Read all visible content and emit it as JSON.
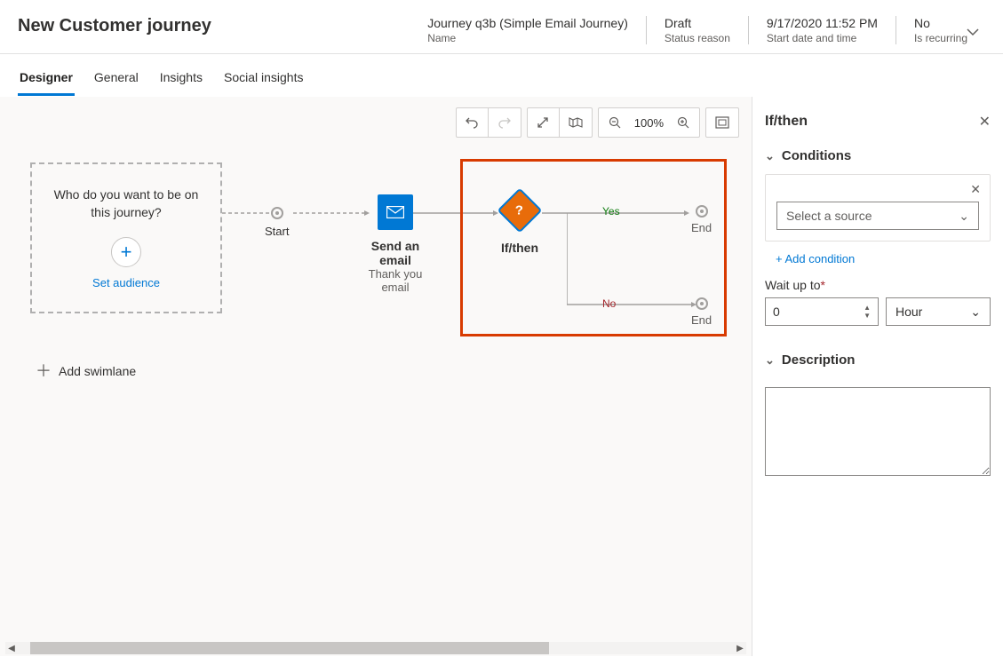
{
  "header": {
    "title": "New Customer journey",
    "fields": [
      {
        "value": "Journey q3b (Simple Email Journey)",
        "label": "Name"
      },
      {
        "value": "Draft",
        "label": "Status reason"
      },
      {
        "value": "9/17/2020 11:52 PM",
        "label": "Start date and time"
      },
      {
        "value": "No",
        "label": "Is recurring"
      }
    ]
  },
  "tabs": [
    "Designer",
    "General",
    "Insights",
    "Social insights"
  ],
  "active_tab": "Designer",
  "toolbar": {
    "zoom": "100%"
  },
  "canvas": {
    "audience_question": "Who do you want to be on this journey?",
    "set_audience": "Set audience",
    "start_label": "Start",
    "email_title": "Send an email",
    "email_sub": "Thank you email",
    "ifthen_title": "If/then",
    "yes": "Yes",
    "no": "No",
    "end": "End",
    "add_swimlane": "Add swimlane"
  },
  "panel": {
    "title": "If/then",
    "conditions_label": "Conditions",
    "select_source": "Select a source",
    "add_condition": "+ Add condition",
    "wait_label": "Wait up to",
    "wait_value": "0",
    "wait_unit": "Hour",
    "description_label": "Description",
    "description_value": ""
  }
}
